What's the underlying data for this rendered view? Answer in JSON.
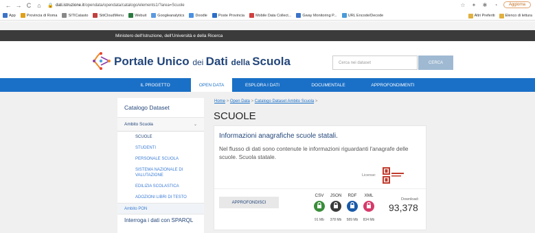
{
  "browser": {
    "url_host": "dati.istruzione.it",
    "url_path": "/opendata/opendata/catalogo/elements1/?area=Scuole",
    "update_button": "Aggiorna",
    "bookmarks": [
      "App",
      "Provincia di Roma",
      "SITICatasto",
      "SitiCloudMenu",
      "Webuit",
      "Googleanalytics",
      "Doodle",
      "Poste Provincia",
      "Mobile Data Collect...",
      "Gway Monitoring P...",
      "URL Encode/Decode"
    ],
    "bookmarks_right": [
      "Altri Preferiti",
      "Elenco di lettura"
    ]
  },
  "site": {
    "ministry": "Ministero dell'Istruzione, dell'Università e della Ricerca",
    "logo_part1": "Portale Unico ",
    "logo_part2": "dei ",
    "logo_part3": "Dati ",
    "logo_part4": "della ",
    "logo_part5": "Scuola",
    "search_placeholder": "Cerca nei dataset",
    "search_button": "CERCA"
  },
  "nav": [
    "IL PROGETTO",
    "OPEN DATA",
    "ESPLORA I DATI",
    "DOCUMENTALE",
    "APPROFONDIMENTI"
  ],
  "sidebar": {
    "title": "Catalogo Dataset",
    "section": "Ambito Scuola",
    "items": [
      "SCUOLE",
      "STUDENTI",
      "PERSONALE SCUOLA",
      "SISTEMA NAZIONALE DI VALUTAZIONE",
      "EDILIZIA SCOLASTICA",
      "ADOZIONI LIBRI DI TESTO"
    ],
    "pon": "Ambito PON",
    "sparql": "Interroga i dati con SPARQL"
  },
  "breadcrumb": {
    "home": "Home",
    "open_data": "Open Data",
    "catalogo": "Catalogo Dataset Ambito Scuola",
    "sep": ">"
  },
  "page_title": "SCUOLE",
  "card": {
    "title": "Informazioni anagrafiche scuole statali.",
    "description": "Nel flusso di dati sono contenute le informazioni riguardanti l'anagrafe delle scuole. Scuola statale.",
    "license_label": "License:",
    "approfondisci": "APPROFONDISCI",
    "formats": [
      {
        "label": "CSV",
        "size": "91 Mb",
        "color": "#3a8d3a"
      },
      {
        "label": "JSON",
        "size": "378 Mb",
        "color": "#3a3a3a"
      },
      {
        "label": "RDF",
        "size": "589 Mb",
        "color": "#1a5aa8"
      },
      {
        "label": "XML",
        "size": "834 Mb",
        "color": "#d63a6a"
      }
    ],
    "download_label": "Download:",
    "download_count": "93,378"
  }
}
